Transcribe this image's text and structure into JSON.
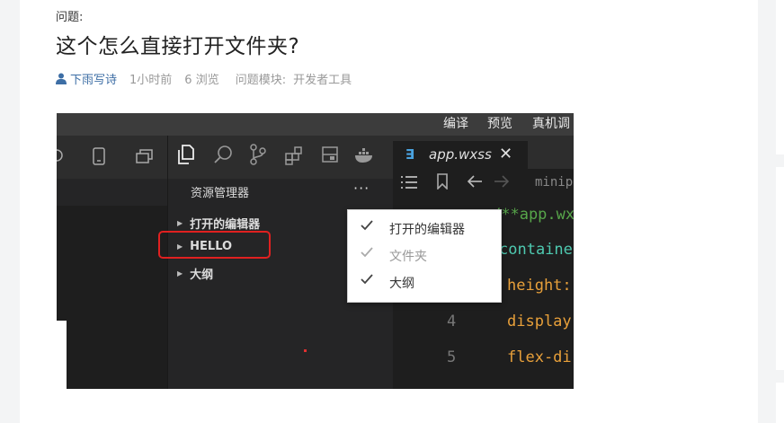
{
  "question": {
    "label": "问题:",
    "title": "这个怎么直接打开文件夹?",
    "author": "下雨写诗",
    "time": "1小时前",
    "views": "6 浏览",
    "module_label": "问题模块:",
    "module_value": "开发者工具"
  },
  "screenshot": {
    "topbar": [
      "编译",
      "预览",
      "真机调"
    ],
    "tab": {
      "label": "app.wxss",
      "icon": "css-icon",
      "close": "✕"
    },
    "breadcrumb": "minipr",
    "explorer": {
      "title": "资源管理器",
      "more": "···",
      "rows": [
        "打开的编辑器",
        "HELLO",
        "大纲"
      ]
    },
    "context_menu": [
      {
        "label": "打开的编辑器",
        "checked": true,
        "disabled": false
      },
      {
        "label": "文件夹",
        "checked": true,
        "disabled": true
      },
      {
        "label": "大纲",
        "checked": true,
        "disabled": false
      }
    ],
    "code_lines": [
      "/**app.wx",
      "containe",
      "height:",
      "display",
      "flex-di"
    ],
    "line_numbers": [
      "4",
      "5"
    ]
  },
  "colors": {
    "link": "#3d6ea5",
    "highlight_box": "#e02020",
    "code_comment": "#57a64a",
    "code_selector": "#4ec9b0",
    "code_property": "#e8a03a"
  }
}
